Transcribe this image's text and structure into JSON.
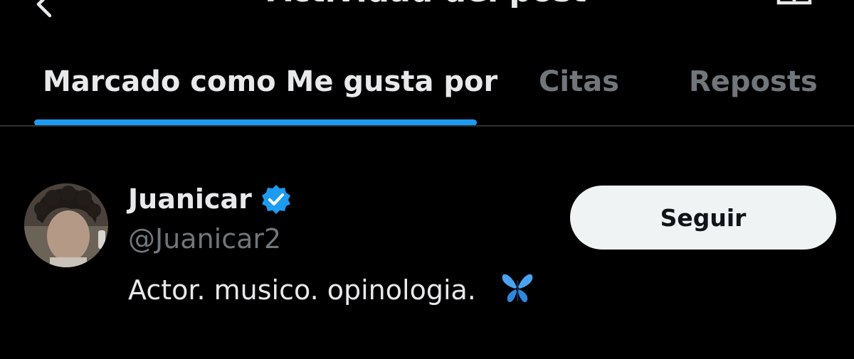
{
  "header": {
    "title": "Actividad del post",
    "back_icon": "chevron-left-icon",
    "action_icon": "share-icon"
  },
  "tabs": [
    {
      "label": "Marcado como Me gusta por",
      "active": true
    },
    {
      "label": "Citas",
      "active": false
    },
    {
      "label": "Reposts",
      "active": false
    }
  ],
  "user": {
    "name": "Juanicar",
    "verified": true,
    "handle": "@Juanicar2",
    "bio": "Actor. musico. opinologia.",
    "bio_emoji": "butterfly-icon",
    "follow_label": "Seguir"
  },
  "colors": {
    "background": "#000000",
    "text_primary": "#e7e9ea",
    "text_secondary": "#71767b",
    "accent": "#1d9bf0",
    "button_bg": "#eff3f4",
    "button_text": "#0f1419",
    "divider": "#2f3336"
  }
}
